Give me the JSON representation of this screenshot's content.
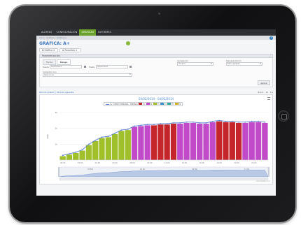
{
  "nav": {
    "items": [
      "ALERTAS",
      "CONFIGURACIÓN",
      "GRÁFICAS",
      "INFORMES"
    ],
    "active_index": 2
  },
  "breadcrumb": "Inicio › Gráficas › Gráfica A+",
  "page": {
    "title": "GRÁFICA: A+"
  },
  "toolbar": {
    "graph_btn": "Gráfica",
    "favs_btn": "Favoritos"
  },
  "params": {
    "header": "Parametrización",
    "tabs": [
      "Fecha",
      "Rango"
    ],
    "active_tab": 1,
    "from_label": "Desde",
    "from_value": "01/03/2014",
    "to_label": "Hasta",
    "to_value": "04/02/2014",
    "comp_label": "Comparar con",
    "comp_value": "Seleccione",
    "group_label": "Agrupación",
    "group_value": "Horaria",
    "repr_label": "Representación",
    "repr_value": "Barra apilada",
    "apply_label": "Aplicar"
  },
  "chart_controls": {
    "nav_text": "Periodo anterior | Periodo siguiente",
    "zoom_label": "Zoom",
    "zoom_options": [
      "1d",
      "1w"
    ]
  },
  "credit": "www.dataflex.com",
  "colors": {
    "line": "#5b7fcf",
    "green": "#9fc02a",
    "magenta": "#c04ac8",
    "red": "#c4262c"
  },
  "chart_data": {
    "type": "bar",
    "title": "03/02/2014 - 04/02/2014",
    "ylabel": "kWh",
    "ylim": [
      0,
      3
    ],
    "yticks": [
      "3k",
      "2k",
      "1k"
    ],
    "legend": [
      "A+ CUENTA PRINCIPAL - ENERGIA",
      "P1",
      "P2",
      "P3",
      "P4",
      "P5",
      "P6"
    ],
    "legend_colors": [
      "#5b7fcf",
      "#c4262c",
      "#c04ac8",
      "#9fc02a",
      "#3a8fd0",
      "#2aa8a0",
      "#d0b020"
    ],
    "x_tick_labels": [
      "00:00",
      "02:00",
      "04:00",
      "06:00",
      "08:00",
      "10:00",
      "12:00",
      "14:00",
      "16:00",
      "18:00",
      "20:00",
      "22:00"
    ],
    "values": [
      0.25,
      0.35,
      0.45,
      0.6,
      0.95,
      1.2,
      1.4,
      1.45,
      1.65,
      1.85,
      1.9,
      2.1,
      2.15,
      2.2,
      2.2,
      2.25,
      2.25,
      2.3,
      2.3,
      2.35,
      2.35,
      2.3,
      2.3,
      2.4,
      2.45,
      2.4,
      2.4,
      2.35,
      2.35,
      2.4,
      2.4,
      2.35
    ],
    "periods": [
      "P3",
      "P3",
      "P3",
      "P3",
      "P3",
      "P3",
      "P3",
      "P3",
      "P3",
      "P3",
      "P3",
      "P2",
      "P2",
      "P2",
      "P1",
      "P1",
      "P1",
      "P1",
      "P2",
      "P2",
      "P2",
      "P2",
      "P2",
      "P2",
      "P1",
      "P1",
      "P1",
      "P1",
      "P2",
      "P2",
      "P2",
      "P2"
    ],
    "period_colors": {
      "P1": "#c4262c",
      "P2": "#c04ac8",
      "P3": "#9fc02a"
    },
    "navigator_labels": [
      "03 Feb",
      "12:00",
      "04 Feb",
      "12:00"
    ]
  }
}
